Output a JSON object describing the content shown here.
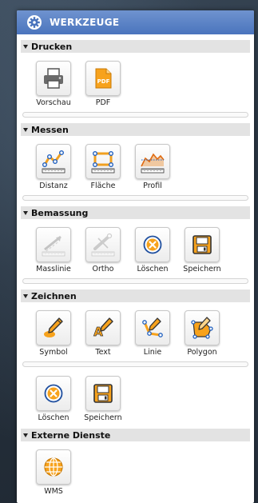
{
  "panel": {
    "title": "WERKZEUGE",
    "icon": "gear-icon"
  },
  "sections": [
    {
      "title": "Drucken",
      "tools": [
        {
          "label": "Vorschau",
          "icon": "printer-icon"
        },
        {
          "label": "PDF",
          "icon": "pdf-icon",
          "badge": "PDF"
        }
      ]
    },
    {
      "title": "Messen",
      "tools": [
        {
          "label": "Distanz",
          "icon": "distance-icon"
        },
        {
          "label": "Fläche",
          "icon": "area-icon"
        },
        {
          "label": "Profil",
          "icon": "profile-icon"
        }
      ]
    },
    {
      "title": "Bemassung",
      "tools": [
        {
          "label": "Masslinie",
          "icon": "dimension-line-icon"
        },
        {
          "label": "Ortho",
          "icon": "ortho-icon"
        },
        {
          "label": "Löschen",
          "icon": "delete-icon"
        },
        {
          "label": "Speichern",
          "icon": "save-icon"
        }
      ]
    },
    {
      "title": "Zeichnen",
      "tools": [
        {
          "label": "Symbol",
          "icon": "symbol-icon"
        },
        {
          "label": "Text",
          "icon": "text-icon",
          "badge": "A"
        },
        {
          "label": "Linie",
          "icon": "line-icon"
        },
        {
          "label": "Polygon",
          "icon": "polygon-icon"
        },
        {
          "label": "Löschen",
          "icon": "delete-icon"
        },
        {
          "label": "Speichern",
          "icon": "save-icon"
        }
      ]
    },
    {
      "title": "Externe Dienste",
      "tools": [
        {
          "label": "WMS",
          "icon": "globe-icon"
        }
      ]
    }
  ],
  "colors": {
    "header": "#4a74bd",
    "accent_orange": "#f0a020",
    "measure_blue": "#1f5fbf"
  }
}
